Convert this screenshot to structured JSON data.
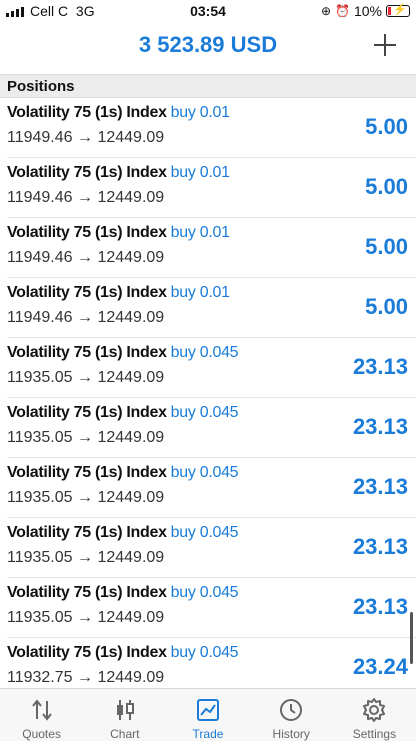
{
  "status_bar": {
    "carrier": "Cell C",
    "network": "3G",
    "time": "03:54",
    "battery": "10%"
  },
  "header": {
    "balance": "3 523.89 USD",
    "add_icon": "plus-icon"
  },
  "section": {
    "title": "Positions"
  },
  "positions": [
    {
      "symbol": "Volatility 75 (1s) Index",
      "direction": "buy",
      "volume": "0.01",
      "open_price": "11949.46",
      "arrow": "→",
      "current_price": "12449.09",
      "profit": "5.00"
    },
    {
      "symbol": "Volatility 75 (1s) Index",
      "direction": "buy",
      "volume": "0.01",
      "open_price": "11949.46",
      "arrow": "→",
      "current_price": "12449.09",
      "profit": "5.00"
    },
    {
      "symbol": "Volatility 75 (1s) Index",
      "direction": "buy",
      "volume": "0.01",
      "open_price": "11949.46",
      "arrow": "→",
      "current_price": "12449.09",
      "profit": "5.00"
    },
    {
      "symbol": "Volatility 75 (1s) Index",
      "direction": "buy",
      "volume": "0.01",
      "open_price": "11949.46",
      "arrow": "→",
      "current_price": "12449.09",
      "profit": "5.00"
    },
    {
      "symbol": "Volatility 75 (1s) Index",
      "direction": "buy",
      "volume": "0.045",
      "open_price": "11935.05",
      "arrow": "→",
      "current_price": "12449.09",
      "profit": "23.13"
    },
    {
      "symbol": "Volatility 75 (1s) Index",
      "direction": "buy",
      "volume": "0.045",
      "open_price": "11935.05",
      "arrow": "→",
      "current_price": "12449.09",
      "profit": "23.13"
    },
    {
      "symbol": "Volatility 75 (1s) Index",
      "direction": "buy",
      "volume": "0.045",
      "open_price": "11935.05",
      "arrow": "→",
      "current_price": "12449.09",
      "profit": "23.13"
    },
    {
      "symbol": "Volatility 75 (1s) Index",
      "direction": "buy",
      "volume": "0.045",
      "open_price": "11935.05",
      "arrow": "→",
      "current_price": "12449.09",
      "profit": "23.13"
    },
    {
      "symbol": "Volatility 75 (1s) Index",
      "direction": "buy",
      "volume": "0.045",
      "open_price": "11935.05",
      "arrow": "→",
      "current_price": "12449.09",
      "profit": "23.13"
    },
    {
      "symbol": "Volatility 75 (1s) Index",
      "direction": "buy",
      "volume": "0.045",
      "open_price": "11932.75",
      "arrow": "→",
      "current_price": "12449.09",
      "profit": "23.24"
    }
  ],
  "tabs": [
    {
      "label": "Quotes",
      "icon": "quotes-icon"
    },
    {
      "label": "Chart",
      "icon": "candlestick-icon"
    },
    {
      "label": "Trade",
      "icon": "trade-chart-icon",
      "active": true
    },
    {
      "label": "History",
      "icon": "history-clock-icon"
    },
    {
      "label": "Settings",
      "icon": "gear-icon"
    }
  ],
  "colors": {
    "accent": "#1a7bd8",
    "battery_low": "#e23"
  }
}
